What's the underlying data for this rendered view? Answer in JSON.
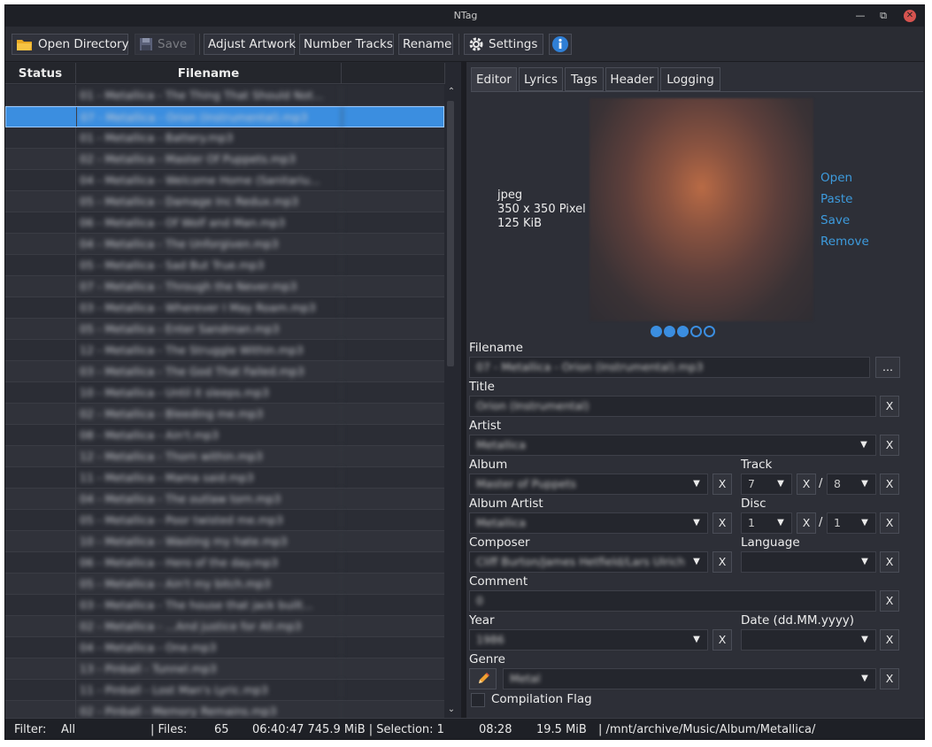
{
  "window": {
    "title": "NTag"
  },
  "toolbar": {
    "open_directory": "Open Directory",
    "save": "Save",
    "adjust_artwork": "Adjust Artwork",
    "number_tracks": "Number Tracks",
    "rename": "Rename",
    "settings": "Settings"
  },
  "file_table": {
    "headers": {
      "status": "Status",
      "filename": "Filename"
    },
    "rows": [
      "01 - Metallica - The Thing That Should Not...",
      "07 - Metallica - Orion (Instrumental).mp3",
      "01 - Metallica - Battery.mp3",
      "02 - Metallica - Master Of Puppets.mp3",
      "04 - Metallica - Welcome Home (Sanitariu...",
      "05 - Metallica - Damage Inc Redux.mp3",
      "06 - Metallica - Of Wolf and Man.mp3",
      "04 - Metallica - The Unforgiven.mp3",
      "05 - Metallica - Sad But True.mp3",
      "07 - Metallica - Through the Never.mp3",
      "03 - Metallica - Wherever I May Roam.mp3",
      "05 - Metallica - Enter Sandman.mp3",
      "12 - Metallica - The Struggle Within.mp3",
      "03 - Metallica - The God That Failed.mp3",
      "10 - Metallica - Until it sleeps.mp3",
      "02 - Metallica - Bleeding me.mp3",
      "08 - Metallica - Ain't.mp3",
      "12 - Metallica - Thorn within.mp3",
      "11 - Metallica - Mama said.mp3",
      "04 - Metallica - The outlaw torn.mp3",
      "05 - Metallica - Poor twisted me.mp3",
      "10 - Metallica - Wasting my hate.mp3",
      "06 - Metallica - Hero of the day.mp3",
      "05 - Metallica - Ain't my bitch.mp3",
      "03 - Metallica - The house that jack built...",
      "02 - Metallica - ...And justice for All.mp3",
      "04 - Metallica - One.mp3",
      "13 - Pinball - Tunnel.mp3",
      "11 - Pinball - Lost Man's Lyric.mp3",
      "02 - Pinball - Memory Remains.mp3"
    ]
  },
  "editor": {
    "tabs": [
      "Editor",
      "Lyrics",
      "Tags",
      "Header",
      "Logging"
    ],
    "artwork": {
      "format": "jpeg",
      "dimensions": "350 x 350 Pixel",
      "size": "125 KiB",
      "actions": [
        "Open",
        "Paste",
        "Save",
        "Remove"
      ],
      "page_count": 5,
      "current_pages": 3
    },
    "labels": {
      "filename": "Filename",
      "title": "Title",
      "artist": "Artist",
      "album": "Album",
      "track": "Track",
      "album_artist": "Album Artist",
      "disc": "Disc",
      "composer": "Composer",
      "language": "Language",
      "comment": "Comment",
      "year": "Year",
      "date": "Date (dd.MM.yyyy)",
      "genre": "Genre",
      "compilation": "Compilation Flag"
    },
    "values": {
      "filename": "07 - Metallica - Orion (Instrumental).mp3",
      "title": "Orion (Instrumental)",
      "artist": "Metallica",
      "album": "Master of Puppets",
      "track": "7",
      "track_total": "8",
      "album_artist": "Metallica",
      "disc": "1",
      "disc_total": "1",
      "composer": "Cliff Burton/James Hetfield/Lars Ulrich",
      "language": "",
      "comment": "0",
      "year": "1986",
      "date": "",
      "genre": "Metal"
    },
    "browse_label": "...",
    "clear_label": "X",
    "separator": "/"
  },
  "status_bar": {
    "filter_label": "Filter:",
    "filter_value": "All",
    "files_label": "| Files:",
    "files_count": "65",
    "total": "06:40:47  745.9 MiB  | Selection: 1",
    "selection_info": "08:28",
    "selection_size": "19.5 MiB",
    "path": "|  /mnt/archive/Music/Album/Metallica/"
  },
  "colors": {
    "accent": "#3b8ee0",
    "link": "#3d9bdd",
    "background": "#2d2f37"
  }
}
